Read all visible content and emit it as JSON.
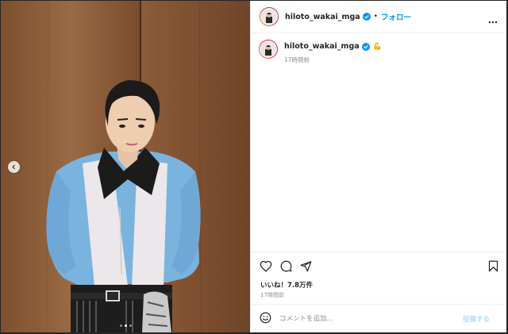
{
  "post": {
    "username": "hiloto_wakai_mga",
    "follow_label": "フォロー",
    "separator": "•",
    "caption_emoji": "💪",
    "caption_time": "17時間前",
    "likes": "いいね！7.8万件",
    "post_time": "17時間前"
  },
  "comment": {
    "placeholder": "コメントを追加...",
    "post_label": "投稿する"
  },
  "carousel": {
    "slide_count": 3,
    "active_index": 1
  },
  "colors": {
    "link": "#0095f6",
    "verified": "#0095f6",
    "post_disabled": "#b2dffc",
    "muted": "#8e8e8e"
  },
  "icons": [
    "chevron-left-icon",
    "verified-badge-icon",
    "more-icon",
    "heart-icon",
    "comment-icon",
    "share-icon",
    "bookmark-icon",
    "emoji-icon"
  ]
}
